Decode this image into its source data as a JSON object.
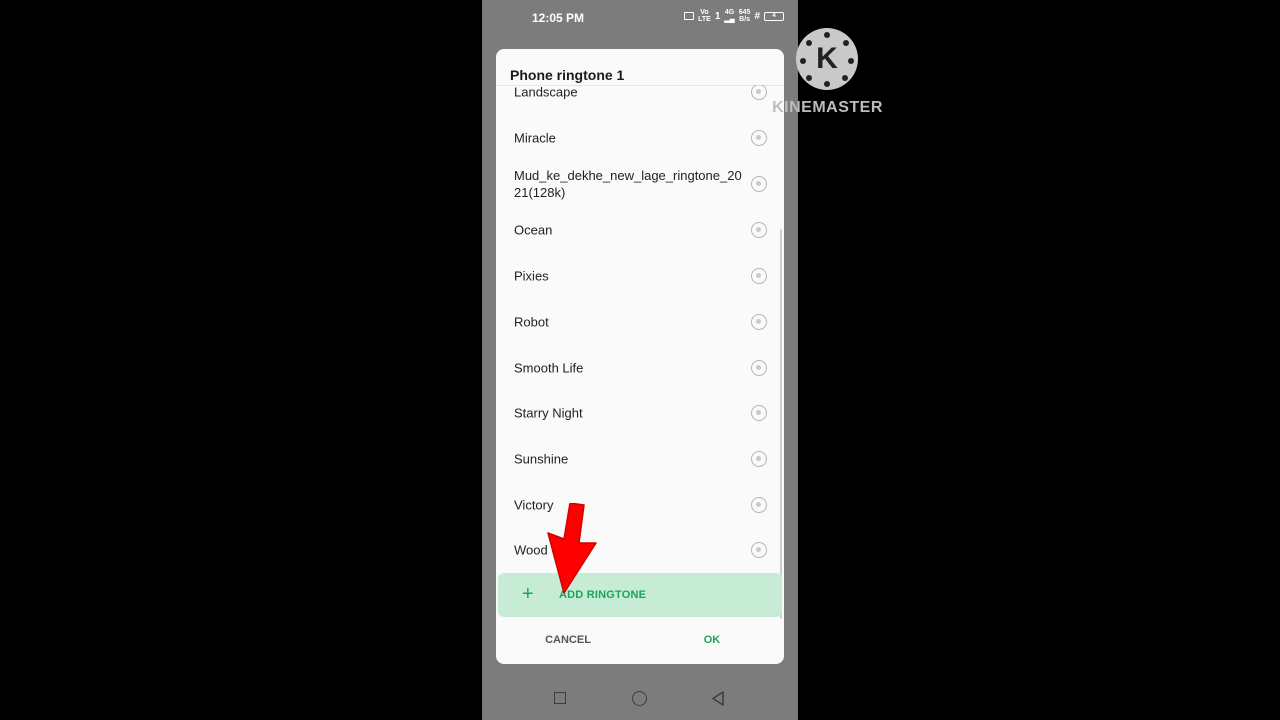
{
  "status_bar": {
    "time": "12:05 PM",
    "volte_top": "Vo",
    "volte_bottom": "LTE",
    "sim_slot": "1",
    "network_type": "4G",
    "speed_value": "645",
    "speed_unit": "B/s",
    "battery_level": "4"
  },
  "dialog": {
    "title": "Phone ringtone 1",
    "items": [
      {
        "label": "Landscape"
      },
      {
        "label": "Miracle"
      },
      {
        "label": "Mud_ke_dekhe_new_lage_ringtone_2021(128k)"
      },
      {
        "label": "Ocean"
      },
      {
        "label": "Pixies"
      },
      {
        "label": "Robot"
      },
      {
        "label": "Smooth Life"
      },
      {
        "label": "Starry Night"
      },
      {
        "label": "Sunshine"
      },
      {
        "label": "Victory"
      },
      {
        "label": "Wood C"
      }
    ],
    "add_button": {
      "icon": "+",
      "label": "ADD RINGTONE"
    },
    "cancel_label": "CANCEL",
    "ok_label": "OK"
  },
  "watermark": {
    "logo_letter": "K",
    "text": "KINEMASTER"
  },
  "colors": {
    "accent_green": "#1ba45a",
    "add_button_bg": "#c7ecd6",
    "annotation_arrow": "#ff0000"
  }
}
